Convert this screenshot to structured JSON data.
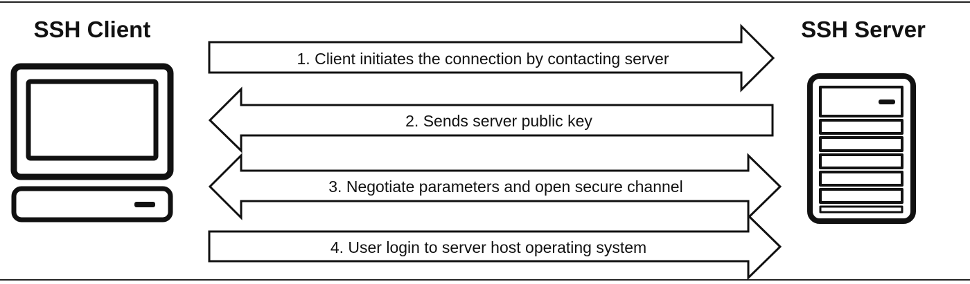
{
  "client": {
    "title": "SSH Client",
    "icon": "desktop-computer-icon"
  },
  "server": {
    "title": "SSH Server",
    "icon": "server-tower-icon"
  },
  "steps": [
    {
      "label": "1. Client initiates the connection by contacting server",
      "direction": "right"
    },
    {
      "label": "2. Sends server public key",
      "direction": "left"
    },
    {
      "label": "3. Negotiate parameters and open secure channel",
      "direction": "both"
    },
    {
      "label": "4. User login to server host operating system",
      "direction": "right"
    }
  ],
  "colors": {
    "stroke": "#111111",
    "background": "#ffffff"
  }
}
